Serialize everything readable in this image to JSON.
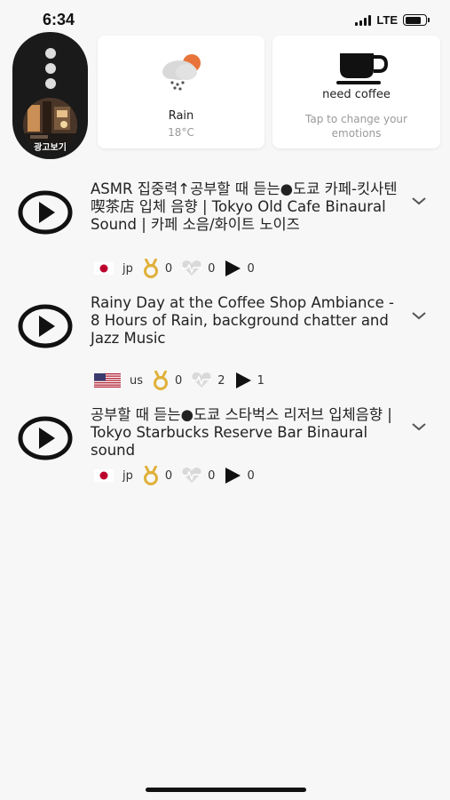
{
  "status_bar": {
    "time": "6:34",
    "network": "LTE"
  },
  "ad": {
    "label": "광고보기"
  },
  "weather": {
    "condition": "Rain",
    "temperature": "18°C",
    "icon": "rain-cloud-sun-icon"
  },
  "emotion": {
    "title": "need coffee",
    "hint": "Tap to change your emotions",
    "icon": "coffee-cup-icon"
  },
  "tracks": [
    {
      "title": "ASMR 집중력↑공부할 때 듣는●도쿄 카페-킷사텐 喫茶店 입체 음향 | Tokyo Old Cafe Binaural Sound | 카페 소음/화이트 노이즈",
      "country": "jp",
      "flag": "japan-flag-icon",
      "medals": "0",
      "hearts": "0",
      "plays": "0"
    },
    {
      "title": "Rainy Day at the Coffee Shop Ambiance - 8 Hours of Rain, background chatter and Jazz Music",
      "country": "us",
      "flag": "us-flag-icon",
      "medals": "0",
      "hearts": "2",
      "plays": "1"
    },
    {
      "title": "공부할 때 듣는●도쿄 스타벅스 리저브 입체음향 | Tokyo Starbucks Reserve Bar Binaural sound",
      "country": "jp",
      "flag": "japan-flag-icon",
      "medals": "0",
      "hearts": "0",
      "plays": "0"
    }
  ],
  "colors": {
    "background": "#f7f7f7",
    "card": "#ffffff",
    "accent_gold": "#e0b13a",
    "flag_red": "#bc002d"
  }
}
